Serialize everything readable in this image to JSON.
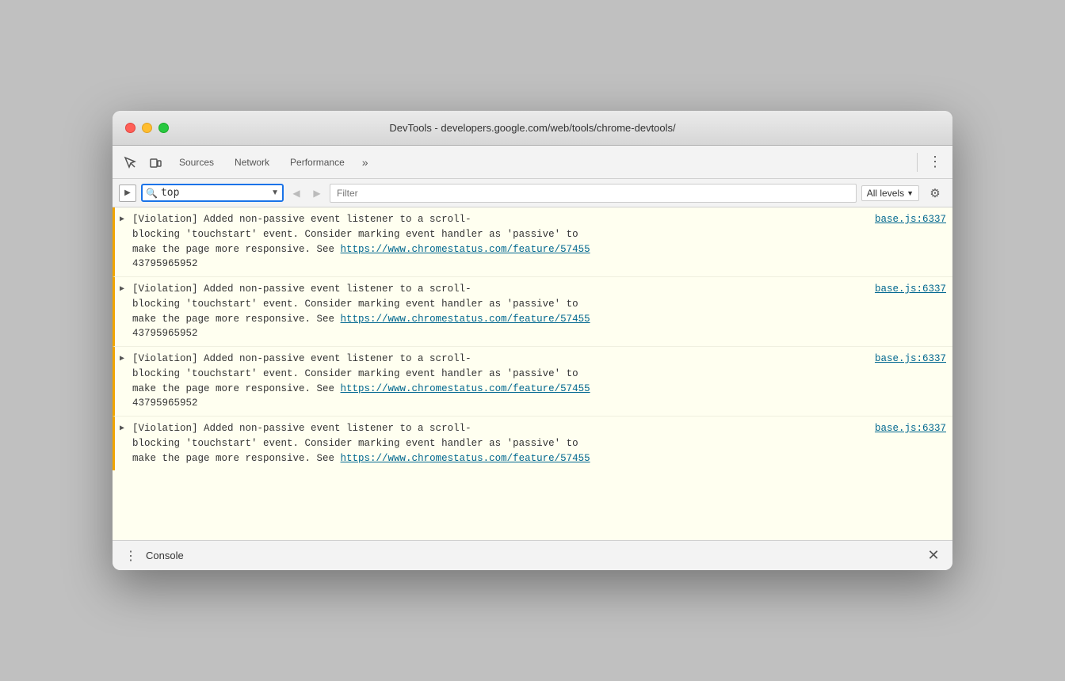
{
  "window": {
    "title": "DevTools - developers.google.com/web/tools/chrome-devtools/"
  },
  "toolbar": {
    "tabs": [
      "Sources",
      "Network",
      "Performance"
    ],
    "more_label": "»",
    "menu_icon": "⋮",
    "inspect_icon": "⬚",
    "device_icon": "▭"
  },
  "console_toolbar": {
    "filter_placeholder": "Filter",
    "filter_value": "",
    "context_value": "top",
    "levels_label": "All levels",
    "levels_arrow": "▼"
  },
  "entries": [
    {
      "arrow": "▶",
      "text_parts": [
        "[Violation] Added non-passive event listener to a scroll-",
        "blocking 'touchstart' event. Consider marking event handler as 'passive' to",
        "make the page more responsive. See https://www.chromestatus.com/feature/57455",
        "43795965952"
      ],
      "link_text": "base.js:6337",
      "link_url": "#",
      "partial": true
    },
    {
      "arrow": "▶",
      "text_parts": [
        "[Violation] Added non-passive event listener to a scroll-",
        "blocking 'touchstart' event. Consider marking event handler as 'passive' to",
        "make the page more responsive. See https://www.chromestatus.com/feature/57455",
        "43795965952"
      ],
      "link_text": "base.js:6337",
      "link_url": "#"
    },
    {
      "arrow": "▶",
      "text_parts": [
        "[Violation] Added non-passive event listener to a scroll-",
        "blocking 'touchstart' event. Consider marking event handler as 'passive' to",
        "make the page more responsive. See https://www.chromestatus.com/feature/57455",
        "43795965952"
      ],
      "link_text": "base.js:6337",
      "link_url": "#"
    },
    {
      "arrow": "▶",
      "text_parts": [
        "[Violation] Added non-passive event listener to a scroll-",
        "blocking 'touchstart' event. Consider marking event handler as 'passive' to",
        "make the page more responsive. See https://www.chromestatus.com/feature/57455",
        ""
      ],
      "link_text": "base.js:6337",
      "link_url": "#",
      "cut_off": true
    }
  ],
  "bottom_bar": {
    "label": "Console",
    "close_icon": "✕",
    "menu_icon": "⋮"
  },
  "highlight": {
    "color": "#1a73e8",
    "border": "2.5px solid #1a73e8"
  }
}
